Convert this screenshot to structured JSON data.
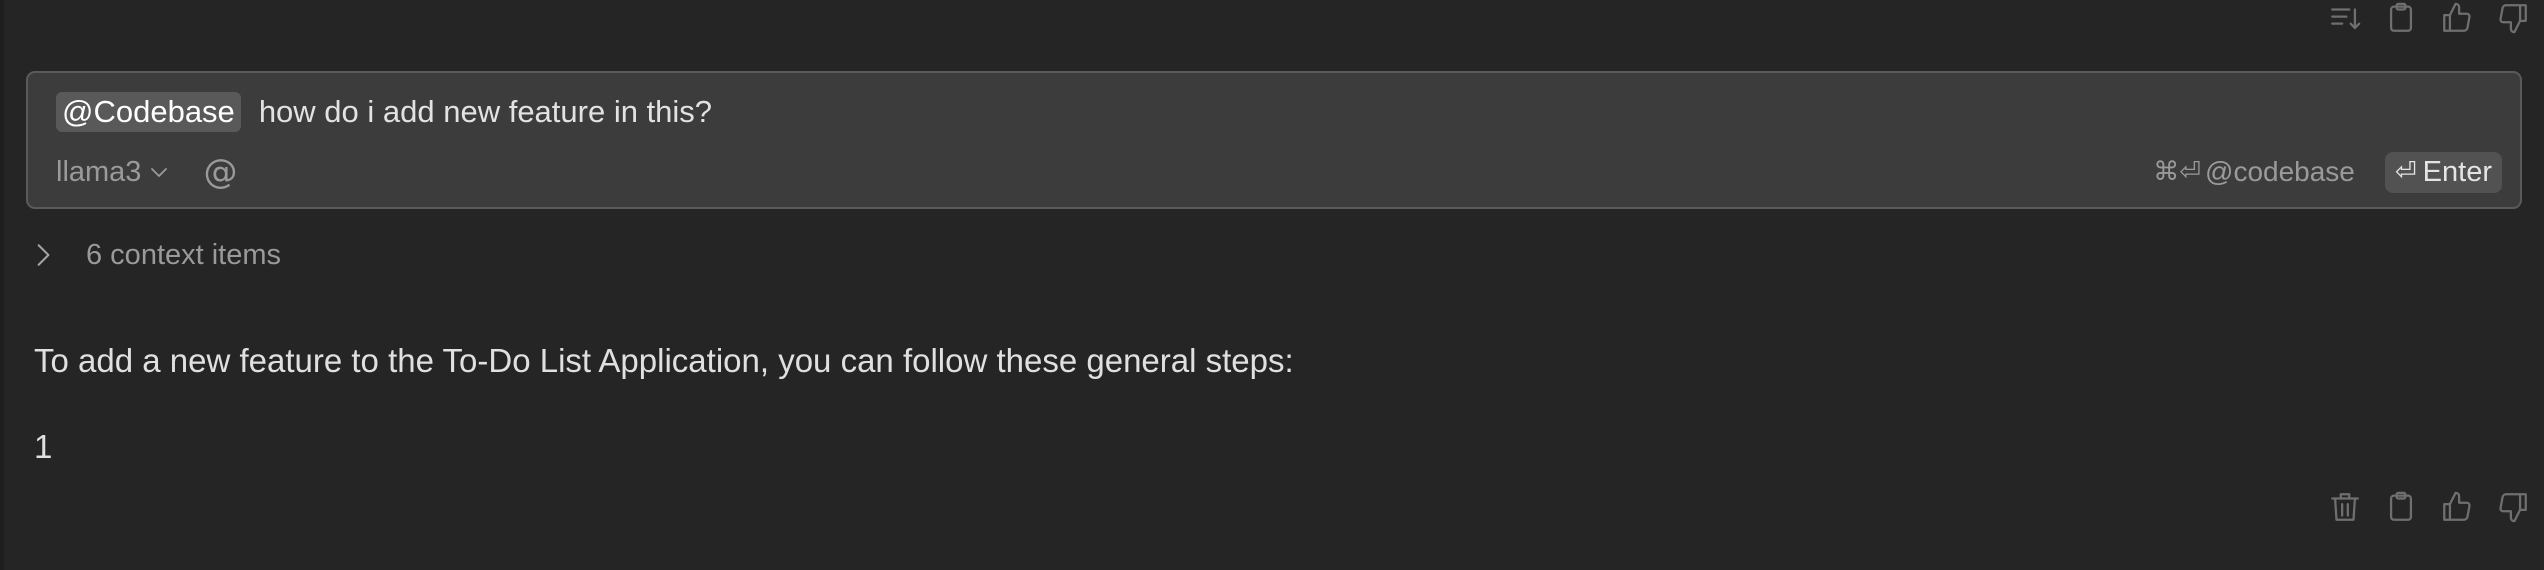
{
  "input": {
    "mention": "@Codebase",
    "query": "how do i add new feature in this?",
    "model": "llama3",
    "at_symbol": "@",
    "shortcut_symbols": "⌘⏎",
    "shortcut_label": "@codebase",
    "enter_symbol": "⏎",
    "enter_label": "Enter"
  },
  "context": {
    "label": "6 context items"
  },
  "response": {
    "text": "To add a new feature to the To-Do List Application, you can follow these general steps:",
    "list_number": "1"
  },
  "icons": {
    "top_actions": [
      "sort-icon",
      "clipboard-icon",
      "thumbs-up-icon",
      "thumbs-down-icon"
    ],
    "bottom_actions": [
      "trash-icon",
      "clipboard-icon",
      "thumbs-up-icon",
      "thumbs-down-icon"
    ]
  }
}
